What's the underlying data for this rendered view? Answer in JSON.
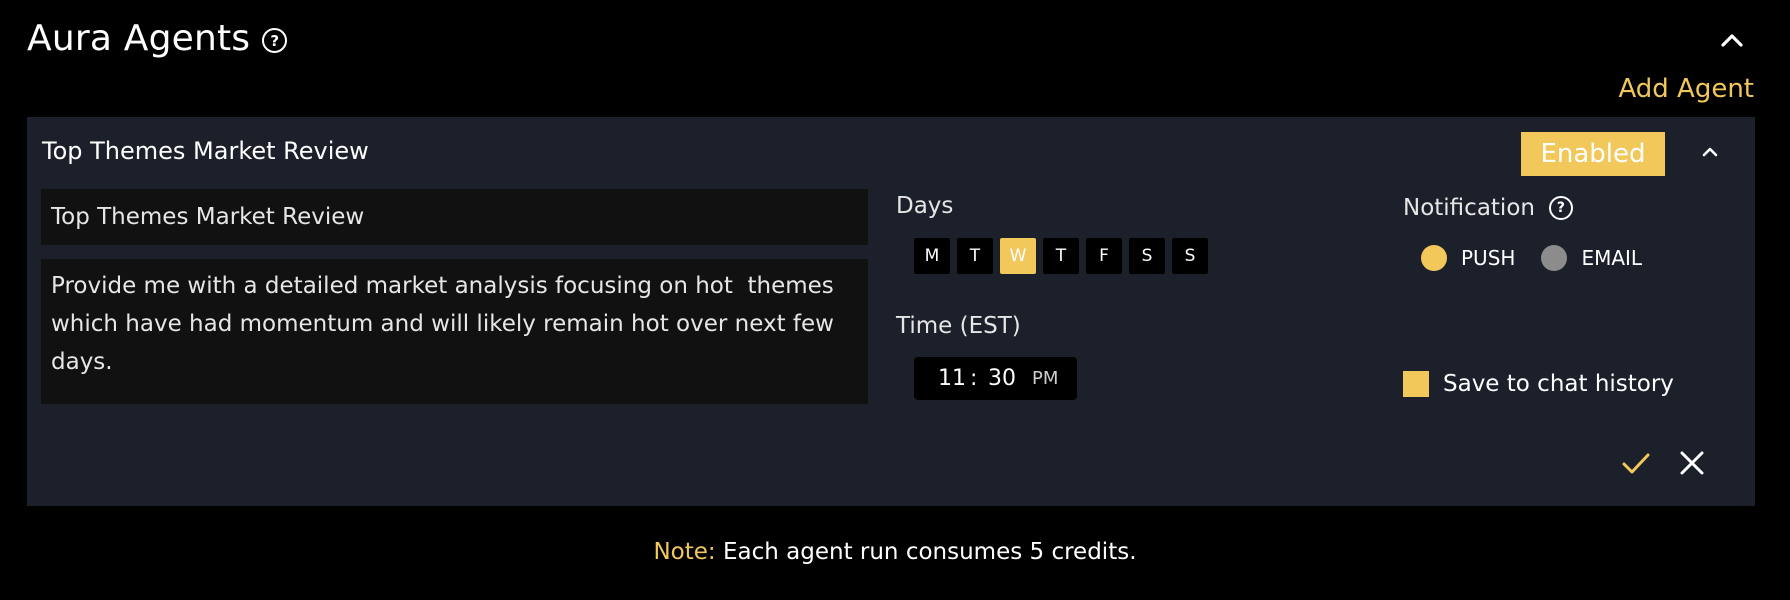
{
  "header": {
    "title": "Aura Agents",
    "help_icon": "question-circle-icon",
    "collapse_icon": "chevron-up-icon"
  },
  "add_agent_label": "Add Agent",
  "agent": {
    "title": "Top Themes Market Review",
    "status": "Enabled",
    "name_value": "Top Themes Market Review",
    "prompt_value": "Provide me with a detailed market analysis focusing on hot  themes which have had momentum and will likely remain hot over next few days.",
    "days_label": "Days",
    "days": [
      {
        "label": "M",
        "selected": false
      },
      {
        "label": "T",
        "selected": false
      },
      {
        "label": "W",
        "selected": true
      },
      {
        "label": "T",
        "selected": false
      },
      {
        "label": "F",
        "selected": false
      },
      {
        "label": "S",
        "selected": false
      },
      {
        "label": "S",
        "selected": false
      }
    ],
    "time_label": "Time (EST)",
    "time": {
      "hour": "11",
      "separator": ":",
      "minute": "30",
      "ampm": "PM"
    },
    "notification_label": "Notification",
    "notification_options": [
      {
        "label": "PUSH",
        "selected": true
      },
      {
        "label": "EMAIL",
        "selected": false
      }
    ],
    "save_to_chat_label": "Save to chat history",
    "save_to_chat_checked": true
  },
  "note": {
    "label": "Note:",
    "text": "Each agent run consumes 5 credits."
  },
  "colors": {
    "accent": "#f2c85b",
    "card_bg": "#1c202a",
    "page_bg": "#000000",
    "field_bg": "#111111"
  }
}
